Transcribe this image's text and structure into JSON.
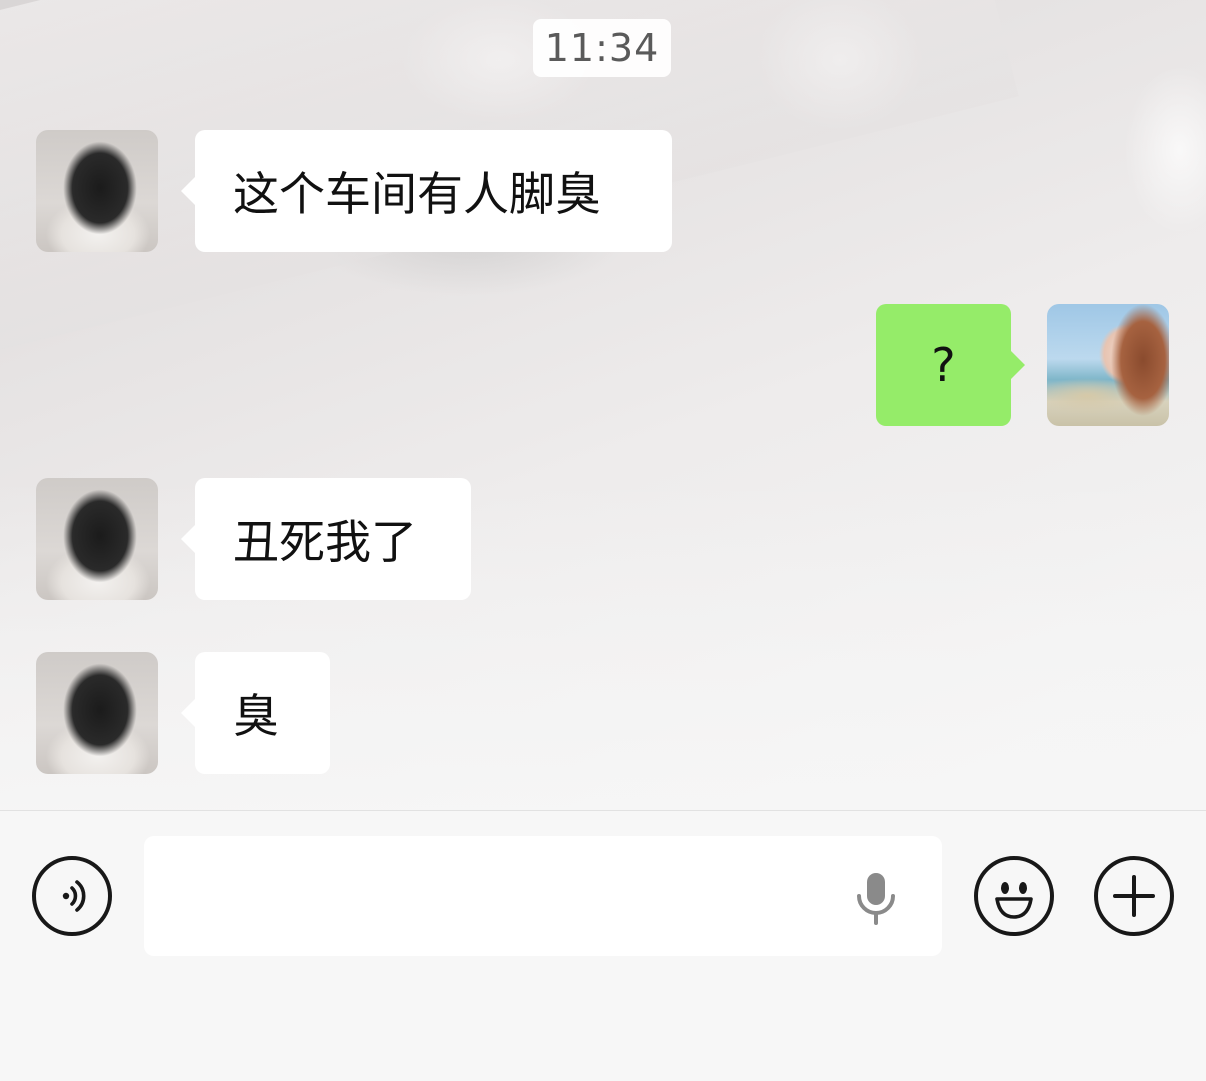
{
  "time": "11:34",
  "messages": [
    {
      "from": "contact",
      "text": "这个车间有人脚臭"
    },
    {
      "from": "me",
      "text": "?"
    },
    {
      "from": "contact",
      "text": "丑死我了"
    },
    {
      "from": "contact",
      "text": "臭"
    }
  ],
  "colors": {
    "outgoing_bubble": "#95ec69",
    "incoming_bubble": "#ffffff",
    "input_bar": "#f7f7f7"
  },
  "input": {
    "value": "",
    "placeholder": ""
  },
  "icons": {
    "voice_toggle": "voice-icon",
    "mic": "microphone-icon",
    "emoji": "emoji-icon",
    "more": "plus-icon"
  }
}
